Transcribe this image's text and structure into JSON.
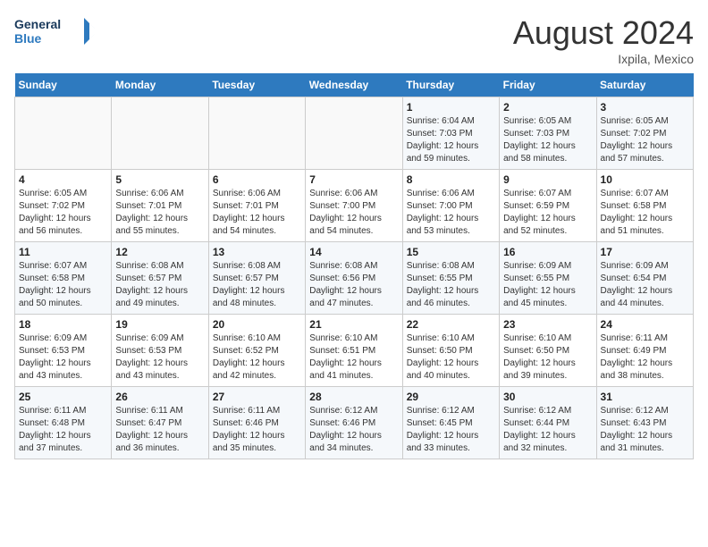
{
  "header": {
    "logo_line1": "General",
    "logo_line2": "Blue",
    "month_year": "August 2024",
    "location": "Ixpila, Mexico"
  },
  "weekdays": [
    "Sunday",
    "Monday",
    "Tuesday",
    "Wednesday",
    "Thursday",
    "Friday",
    "Saturday"
  ],
  "weeks": [
    [
      {
        "day": "",
        "sunrise": "",
        "sunset": "",
        "daylight": ""
      },
      {
        "day": "",
        "sunrise": "",
        "sunset": "",
        "daylight": ""
      },
      {
        "day": "",
        "sunrise": "",
        "sunset": "",
        "daylight": ""
      },
      {
        "day": "",
        "sunrise": "",
        "sunset": "",
        "daylight": ""
      },
      {
        "day": "1",
        "sunrise": "Sunrise: 6:04 AM",
        "sunset": "Sunset: 7:03 PM",
        "daylight": "Daylight: 12 hours and 59 minutes."
      },
      {
        "day": "2",
        "sunrise": "Sunrise: 6:05 AM",
        "sunset": "Sunset: 7:03 PM",
        "daylight": "Daylight: 12 hours and 58 minutes."
      },
      {
        "day": "3",
        "sunrise": "Sunrise: 6:05 AM",
        "sunset": "Sunset: 7:02 PM",
        "daylight": "Daylight: 12 hours and 57 minutes."
      }
    ],
    [
      {
        "day": "4",
        "sunrise": "Sunrise: 6:05 AM",
        "sunset": "Sunset: 7:02 PM",
        "daylight": "Daylight: 12 hours and 56 minutes."
      },
      {
        "day": "5",
        "sunrise": "Sunrise: 6:06 AM",
        "sunset": "Sunset: 7:01 PM",
        "daylight": "Daylight: 12 hours and 55 minutes."
      },
      {
        "day": "6",
        "sunrise": "Sunrise: 6:06 AM",
        "sunset": "Sunset: 7:01 PM",
        "daylight": "Daylight: 12 hours and 54 minutes."
      },
      {
        "day": "7",
        "sunrise": "Sunrise: 6:06 AM",
        "sunset": "Sunset: 7:00 PM",
        "daylight": "Daylight: 12 hours and 54 minutes."
      },
      {
        "day": "8",
        "sunrise": "Sunrise: 6:06 AM",
        "sunset": "Sunset: 7:00 PM",
        "daylight": "Daylight: 12 hours and 53 minutes."
      },
      {
        "day": "9",
        "sunrise": "Sunrise: 6:07 AM",
        "sunset": "Sunset: 6:59 PM",
        "daylight": "Daylight: 12 hours and 52 minutes."
      },
      {
        "day": "10",
        "sunrise": "Sunrise: 6:07 AM",
        "sunset": "Sunset: 6:58 PM",
        "daylight": "Daylight: 12 hours and 51 minutes."
      }
    ],
    [
      {
        "day": "11",
        "sunrise": "Sunrise: 6:07 AM",
        "sunset": "Sunset: 6:58 PM",
        "daylight": "Daylight: 12 hours and 50 minutes."
      },
      {
        "day": "12",
        "sunrise": "Sunrise: 6:08 AM",
        "sunset": "Sunset: 6:57 PM",
        "daylight": "Daylight: 12 hours and 49 minutes."
      },
      {
        "day": "13",
        "sunrise": "Sunrise: 6:08 AM",
        "sunset": "Sunset: 6:57 PM",
        "daylight": "Daylight: 12 hours and 48 minutes."
      },
      {
        "day": "14",
        "sunrise": "Sunrise: 6:08 AM",
        "sunset": "Sunset: 6:56 PM",
        "daylight": "Daylight: 12 hours and 47 minutes."
      },
      {
        "day": "15",
        "sunrise": "Sunrise: 6:08 AM",
        "sunset": "Sunset: 6:55 PM",
        "daylight": "Daylight: 12 hours and 46 minutes."
      },
      {
        "day": "16",
        "sunrise": "Sunrise: 6:09 AM",
        "sunset": "Sunset: 6:55 PM",
        "daylight": "Daylight: 12 hours and 45 minutes."
      },
      {
        "day": "17",
        "sunrise": "Sunrise: 6:09 AM",
        "sunset": "Sunset: 6:54 PM",
        "daylight": "Daylight: 12 hours and 44 minutes."
      }
    ],
    [
      {
        "day": "18",
        "sunrise": "Sunrise: 6:09 AM",
        "sunset": "Sunset: 6:53 PM",
        "daylight": "Daylight: 12 hours and 43 minutes."
      },
      {
        "day": "19",
        "sunrise": "Sunrise: 6:09 AM",
        "sunset": "Sunset: 6:53 PM",
        "daylight": "Daylight: 12 hours and 43 minutes."
      },
      {
        "day": "20",
        "sunrise": "Sunrise: 6:10 AM",
        "sunset": "Sunset: 6:52 PM",
        "daylight": "Daylight: 12 hours and 42 minutes."
      },
      {
        "day": "21",
        "sunrise": "Sunrise: 6:10 AM",
        "sunset": "Sunset: 6:51 PM",
        "daylight": "Daylight: 12 hours and 41 minutes."
      },
      {
        "day": "22",
        "sunrise": "Sunrise: 6:10 AM",
        "sunset": "Sunset: 6:50 PM",
        "daylight": "Daylight: 12 hours and 40 minutes."
      },
      {
        "day": "23",
        "sunrise": "Sunrise: 6:10 AM",
        "sunset": "Sunset: 6:50 PM",
        "daylight": "Daylight: 12 hours and 39 minutes."
      },
      {
        "day": "24",
        "sunrise": "Sunrise: 6:11 AM",
        "sunset": "Sunset: 6:49 PM",
        "daylight": "Daylight: 12 hours and 38 minutes."
      }
    ],
    [
      {
        "day": "25",
        "sunrise": "Sunrise: 6:11 AM",
        "sunset": "Sunset: 6:48 PM",
        "daylight": "Daylight: 12 hours and 37 minutes."
      },
      {
        "day": "26",
        "sunrise": "Sunrise: 6:11 AM",
        "sunset": "Sunset: 6:47 PM",
        "daylight": "Daylight: 12 hours and 36 minutes."
      },
      {
        "day": "27",
        "sunrise": "Sunrise: 6:11 AM",
        "sunset": "Sunset: 6:46 PM",
        "daylight": "Daylight: 12 hours and 35 minutes."
      },
      {
        "day": "28",
        "sunrise": "Sunrise: 6:12 AM",
        "sunset": "Sunset: 6:46 PM",
        "daylight": "Daylight: 12 hours and 34 minutes."
      },
      {
        "day": "29",
        "sunrise": "Sunrise: 6:12 AM",
        "sunset": "Sunset: 6:45 PM",
        "daylight": "Daylight: 12 hours and 33 minutes."
      },
      {
        "day": "30",
        "sunrise": "Sunrise: 6:12 AM",
        "sunset": "Sunset: 6:44 PM",
        "daylight": "Daylight: 12 hours and 32 minutes."
      },
      {
        "day": "31",
        "sunrise": "Sunrise: 6:12 AM",
        "sunset": "Sunset: 6:43 PM",
        "daylight": "Daylight: 12 hours and 31 minutes."
      }
    ]
  ]
}
